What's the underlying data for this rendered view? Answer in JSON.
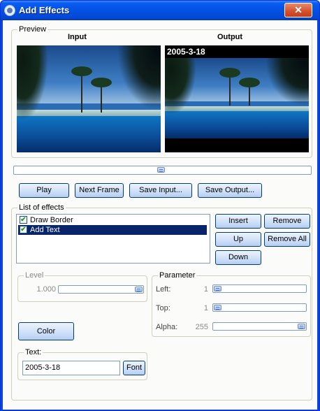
{
  "window": {
    "title": "Add Effects",
    "close_glyph": "✕"
  },
  "preview": {
    "group_label": "Preview",
    "input_label": "Input",
    "output_label": "Output",
    "overlay_text": "2005-3-18"
  },
  "buttons": {
    "play": "Play",
    "next_frame": "Next Frame",
    "save_input": "Save Input...",
    "save_output": "Save Output..."
  },
  "effects": {
    "group_label": "List of effects",
    "items": [
      {
        "label": "Draw Border",
        "checked": true,
        "selected": false
      },
      {
        "label": "Add Text",
        "checked": true,
        "selected": true
      }
    ],
    "insert": "Insert",
    "remove": "Remove",
    "up": "Up",
    "remove_all": "Remove All",
    "down": "Down"
  },
  "level": {
    "group_label": "Level",
    "value": "1.000"
  },
  "parameter": {
    "group_label": "Parameter",
    "rows": [
      {
        "label": "Left:",
        "value": "1"
      },
      {
        "label": "Top:",
        "value": "1"
      },
      {
        "label": "Alpha:",
        "value": "255"
      }
    ]
  },
  "color_button": "Color",
  "text": {
    "group_label": "Text:",
    "value": "2005-3-18",
    "font_button": "Font"
  }
}
